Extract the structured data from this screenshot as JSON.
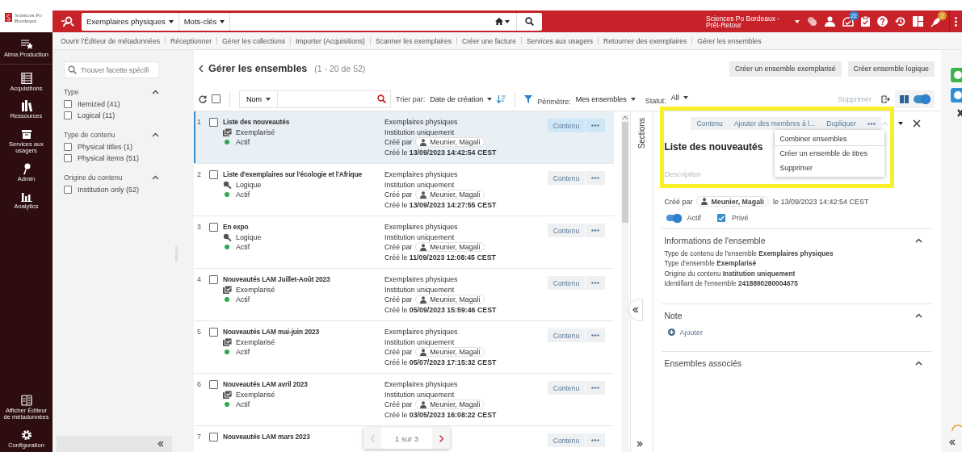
{
  "logo": {
    "text": "Sciences Po Bordeaux"
  },
  "search": {
    "scope": "Exemplaires physiques",
    "field": "Mots-clés"
  },
  "institution": "Sciences Po Bordeaux - Prêt-Retour",
  "header_badges": {
    "tasks": "22",
    "alerts": "2"
  },
  "menu": [
    "Ouvrir l'Éditeur de métadonnées",
    "Réceptionner",
    "Gérer les collections",
    "Importer (Acquisitions)",
    "Scanner les exemplaires",
    "Créer une facture",
    "Services aux usagers",
    "Retourner des exemplaires",
    "Gérer les ensembles"
  ],
  "nav": {
    "top": [
      {
        "label": "Alma Production",
        "kind": "alma"
      },
      {
        "label": "Acquisitions",
        "kind": "acquisitions"
      },
      {
        "label": "Ressources",
        "kind": "resources"
      },
      {
        "label": "Services aux usagers",
        "kind": "services"
      },
      {
        "label": "Admin",
        "kind": "admin"
      },
      {
        "label": "Analytics",
        "kind": "analytics"
      }
    ],
    "bottom": [
      {
        "label": "Afficher Éditeur de métadonnées",
        "kind": "editor"
      },
      {
        "label": "Configuration",
        "kind": "settings"
      }
    ]
  },
  "facets": {
    "placeholder": "Trouver facette spécifi",
    "groups": [
      {
        "title": "Type",
        "expanded": true,
        "options": [
          {
            "label": "Itemized (41)",
            "checked": false
          },
          {
            "label": "Logical (11)",
            "checked": false
          }
        ]
      },
      {
        "title": "Type de contenu",
        "expanded": true,
        "options": [
          {
            "label": "Physical titles (1)",
            "checked": false
          },
          {
            "label": "Physical items (51)",
            "checked": false
          }
        ]
      },
      {
        "title": "Origine du contenu",
        "expanded": true,
        "options": [
          {
            "label": "Institution only (52)",
            "checked": false
          }
        ]
      }
    ]
  },
  "page": {
    "title": "Gérer les ensembles",
    "count": "(1 - 20 de 52)",
    "actions": [
      "Créer un ensemble exemplarisé",
      "Créer ensemble logique"
    ]
  },
  "toolbar": {
    "select_all": false,
    "name_filter": "Nom",
    "sort_label": "Trier par:",
    "sort_value": "Date de création",
    "scope_label": "Périmètre:",
    "scope_value": "Mes ensembles",
    "status_label": "Statut:",
    "status_value": "All",
    "delete": {
      "label": "Supprimer",
      "disabled": true
    },
    "view_toggle": {
      "on": true
    }
  },
  "sets": [
    {
      "number": "1",
      "name": "Liste des nouveautés",
      "kind": "itemized",
      "type": "Exemplarisé",
      "status": "Actif",
      "content_type": "Exemplaires physiques",
      "origin": "Institution uniquement",
      "created_by_label": "Créé par",
      "creator": "Meunier, Magali",
      "created": "Créé le **13/09/2023 14:42:54 CEST**",
      "content_button": "Contenu",
      "selected": true,
      "checked": false
    },
    {
      "number": "2",
      "name": "Liste d'exemplaires sur l'écologie et l'Afrique",
      "kind": "logical",
      "type": "Logique",
      "status": "Actif",
      "content_type": "Exemplaires physiques",
      "origin": "Institution uniquement",
      "created_by_label": "Créé par",
      "creator": "Meunier, Magali",
      "created": "Créé le **13/09/2023 14:27:55 CEST**",
      "content_button": "Contenu",
      "selected": false,
      "checked": false
    },
    {
      "number": "3",
      "name": "En expo",
      "kind": "logical",
      "type": "Logique",
      "status": "Actif",
      "content_type": "Exemplaires physiques",
      "origin": "Institution uniquement",
      "created_by_label": "Créé par",
      "creator": "Meunier, Magali",
      "created": "Créé le **11/09/2023 12:08:45 CEST**",
      "content_button": "Contenu",
      "selected": false,
      "checked": false
    },
    {
      "number": "4",
      "name": "Nouveautés LAM Juillet-Août 2023",
      "kind": "itemized",
      "type": "Exemplarisé",
      "status": "Actif",
      "content_type": "Exemplaires physiques",
      "origin": "Institution uniquement",
      "created_by_label": "Créé par",
      "creator": "Meunier, Magali",
      "created": "Créé le **05/09/2023 15:59:46 CEST**",
      "content_button": "Contenu",
      "selected": false,
      "checked": false
    },
    {
      "number": "5",
      "name": "Nouveautés LAM mai-juin 2023",
      "kind": "itemized",
      "type": "Exemplarisé",
      "status": "Actif",
      "content_type": "Exemplaires physiques",
      "origin": "Institution uniquement",
      "created_by_label": "Créé par",
      "creator": "Meunier, Magali",
      "created": "Créé le **05/07/2023 17:15:32 CEST**",
      "content_button": "Contenu",
      "selected": false,
      "checked": false
    },
    {
      "number": "6",
      "name": "Nouveautés LAM avril 2023",
      "kind": "itemized",
      "type": "Exemplarisé",
      "status": "Actif",
      "content_type": "Exemplaires physiques",
      "origin": "Institution uniquement",
      "created_by_label": "Créé par",
      "creator": "Meunier, Magali",
      "created": "Créé le **03/05/2023 16:08:22 CEST**",
      "content_button": "Contenu",
      "selected": false,
      "checked": false
    },
    {
      "number": "7",
      "name": "Nouveautés LAM mars 2023",
      "content_button": "Contenu",
      "selected": false,
      "checked": false
    }
  ],
  "pager": {
    "label": "1 sur 3",
    "prev_disabled": true,
    "next_disabled": false
  },
  "sections_label": "Sections",
  "detail": {
    "tabs": [
      "Contenu",
      "Ajouter des membres à l...",
      "Dupliquer"
    ],
    "menu": {
      "open": true,
      "items": [
        {
          "label": "Combiner ensembles",
          "selected": true
        },
        {
          "label": "Créer un ensemble de titres",
          "selected": false
        },
        {
          "label": "Supprimer",
          "selected": false
        }
      ]
    },
    "title": "Liste des nouveautés",
    "description_placeholder": "Description",
    "created_by_label": "Créé par",
    "creator": "Meunier, Magali",
    "created_date": "le 13/09/2023 14:42:54 CEST",
    "active": {
      "label": "Actif",
      "on": true
    },
    "private": {
      "label": "Privé",
      "checked": true
    },
    "sections": [
      {
        "title": "Informations de l'ensemble",
        "expanded": true,
        "lines": [
          "Type de contenu de l'ensemble **Exemplaires physiques**",
          "Type d'ensemble **Exemplarisé**",
          "Origine du contenu **Institution uniquement**",
          "Identifiant de l'ensemble **2418890280004675**"
        ]
      },
      {
        "title": "Note",
        "expanded": true,
        "add": "Ajouter"
      },
      {
        "title": "Ensembles associés",
        "expanded": true
      }
    ]
  }
}
